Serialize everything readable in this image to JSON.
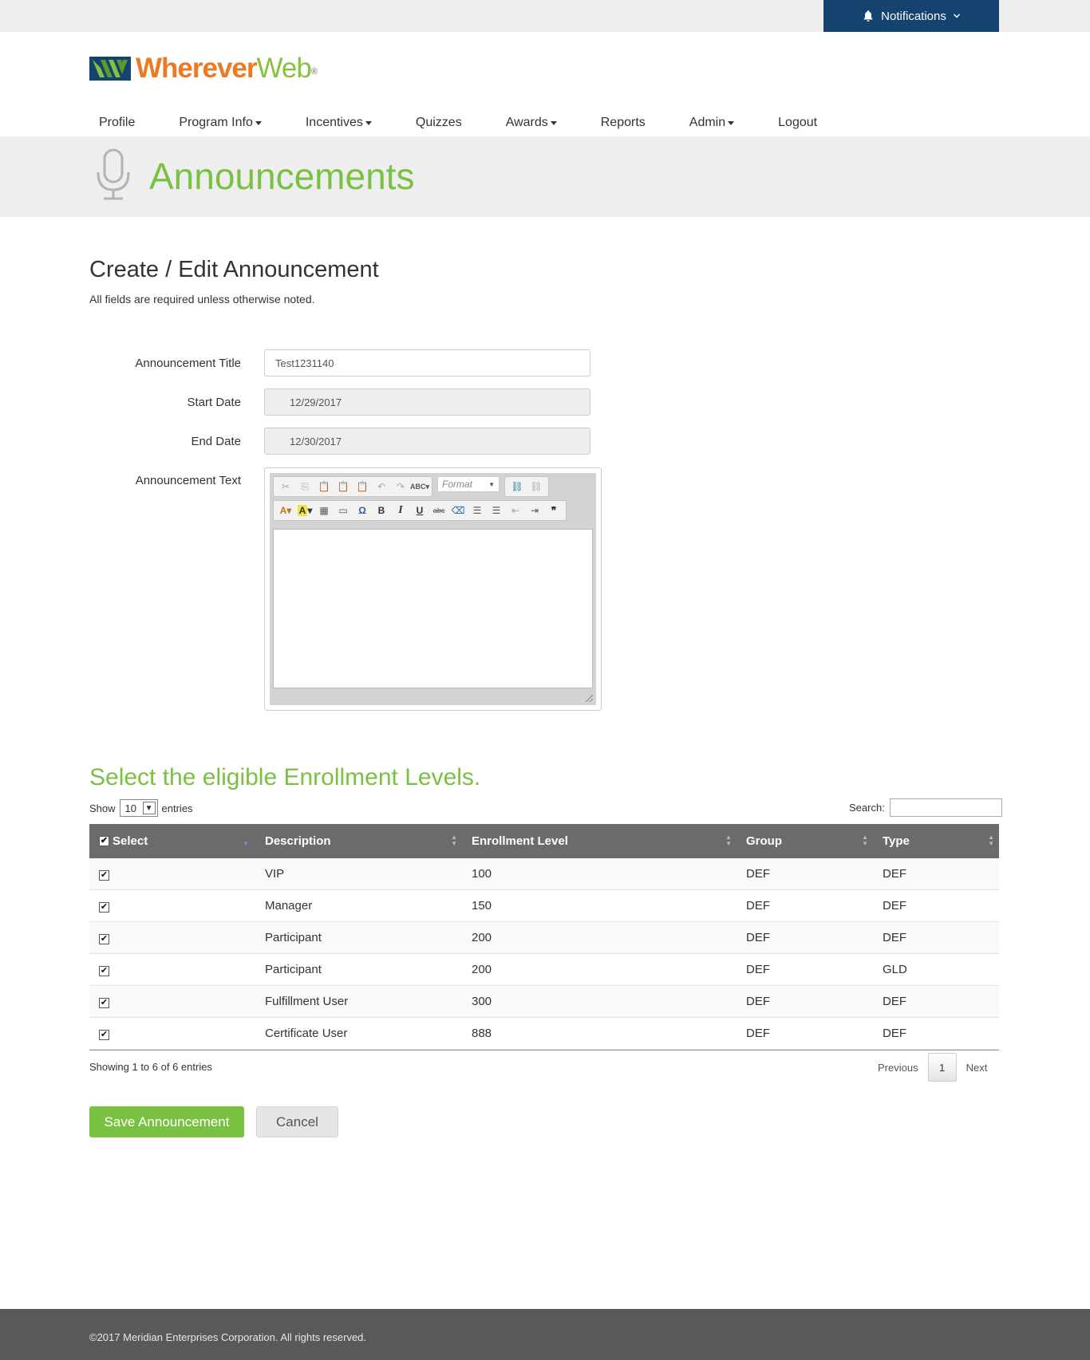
{
  "notifications": {
    "label": "Notifications"
  },
  "brand": {
    "part1": "Wherever",
    "part2": "Web",
    "mark": "®"
  },
  "nav": [
    {
      "label": "Profile",
      "dropdown": false
    },
    {
      "label": "Program Info",
      "dropdown": true
    },
    {
      "label": "Incentives",
      "dropdown": true
    },
    {
      "label": "Quizzes",
      "dropdown": false
    },
    {
      "label": "Awards",
      "dropdown": true
    },
    {
      "label": "Reports",
      "dropdown": false
    },
    {
      "label": "Admin",
      "dropdown": true
    },
    {
      "label": "Logout",
      "dropdown": false
    }
  ],
  "banner": {
    "title": "Announcements"
  },
  "form": {
    "heading": "Create / Edit Announcement",
    "note": "All fields are required unless otherwise noted.",
    "title_label": "Announcement Title",
    "title_value": "Test1231140",
    "start_label": "Start Date",
    "start_value": "12/29/2017",
    "end_label": "End Date",
    "end_value": "12/30/2017",
    "text_label": "Announcement Text",
    "format_label": "Format"
  },
  "levels": {
    "heading": "Select the eligible Enrollment Levels.",
    "show_label": "Show",
    "entries_label": "entries",
    "page_size": "10",
    "search_label": "Search:",
    "columns": [
      "Select",
      "Description",
      "Enrollment Level",
      "Group",
      "Type"
    ],
    "rows": [
      {
        "selected": true,
        "description": "VIP",
        "level": "100",
        "group": "DEF",
        "type": "DEF"
      },
      {
        "selected": true,
        "description": "Manager",
        "level": "150",
        "group": "DEF",
        "type": "DEF"
      },
      {
        "selected": true,
        "description": "Participant",
        "level": "200",
        "group": "DEF",
        "type": "DEF"
      },
      {
        "selected": true,
        "description": "Participant",
        "level": "200",
        "group": "DEF",
        "type": "GLD"
      },
      {
        "selected": true,
        "description": "Fulfillment User",
        "level": "300",
        "group": "DEF",
        "type": "DEF"
      },
      {
        "selected": true,
        "description": "Certificate User",
        "level": "888",
        "group": "DEF",
        "type": "DEF"
      }
    ],
    "info": "Showing 1 to 6 of 6 entries",
    "previous_label": "Previous",
    "current_page": "1",
    "next_label": "Next"
  },
  "actions": {
    "save_label": "Save Announcement",
    "cancel_label": "Cancel"
  },
  "footer": {
    "copyright": "©2017 Meridian Enterprises Corporation. All rights reserved."
  },
  "colors": {
    "brand_green": "#7ac143",
    "brand_orange": "#ec7a23",
    "navy": "#13436e",
    "table_header": "#6b6b6b",
    "footer": "#595959"
  }
}
